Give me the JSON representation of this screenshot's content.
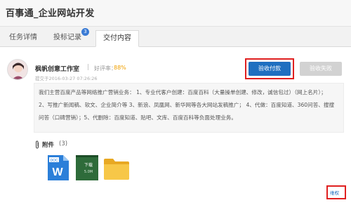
{
  "header": {
    "title": "百事通_企业网站开发"
  },
  "tabs": [
    {
      "label": "任务详情"
    },
    {
      "label": "投标记录",
      "badge": "3"
    },
    {
      "label": "交付内容"
    }
  ],
  "submission": {
    "studio_name": "枫帆创意工作室",
    "separator": "|",
    "rating_label": "好评率：",
    "rating_value": "88%",
    "submit_time": "提交于2016-03-27 07:26:26",
    "accept_label": "验收付款",
    "reject_label": "验收失败",
    "description_lines": [
      "我们主营百度产品等网络推广营销业务： 1、专业代客户创建：百度百科（大量操单创建、修改，诚信包过）（网上名片）；",
      "2、写推广新闻稿、软文、企业简介等 3、新浪、凤凰网、新华网等各大网站发稿推广； 4、代做：百度知道、360问答、搜搜",
      "问答（口碑营销）；5、代删除：百度知道、贴吧、文库、百度百科等负面处理业务。"
    ]
  },
  "attachments": {
    "title": "附件",
    "count": "(3)",
    "files": [
      {
        "icon": "word-doc-icon",
        "label": "W",
        "tag": "DOC"
      },
      {
        "icon": "download-file-icon",
        "label": "下载",
        "sublabel": "5.0M"
      },
      {
        "icon": "folder-icon"
      }
    ]
  },
  "footer": {
    "link_label": "维权"
  },
  "colors": {
    "accent_blue": "#1f6fc0",
    "highlight_red": "#e02020",
    "rating_orange": "#f0a000",
    "disabled_gray": "#d2d2d2"
  }
}
